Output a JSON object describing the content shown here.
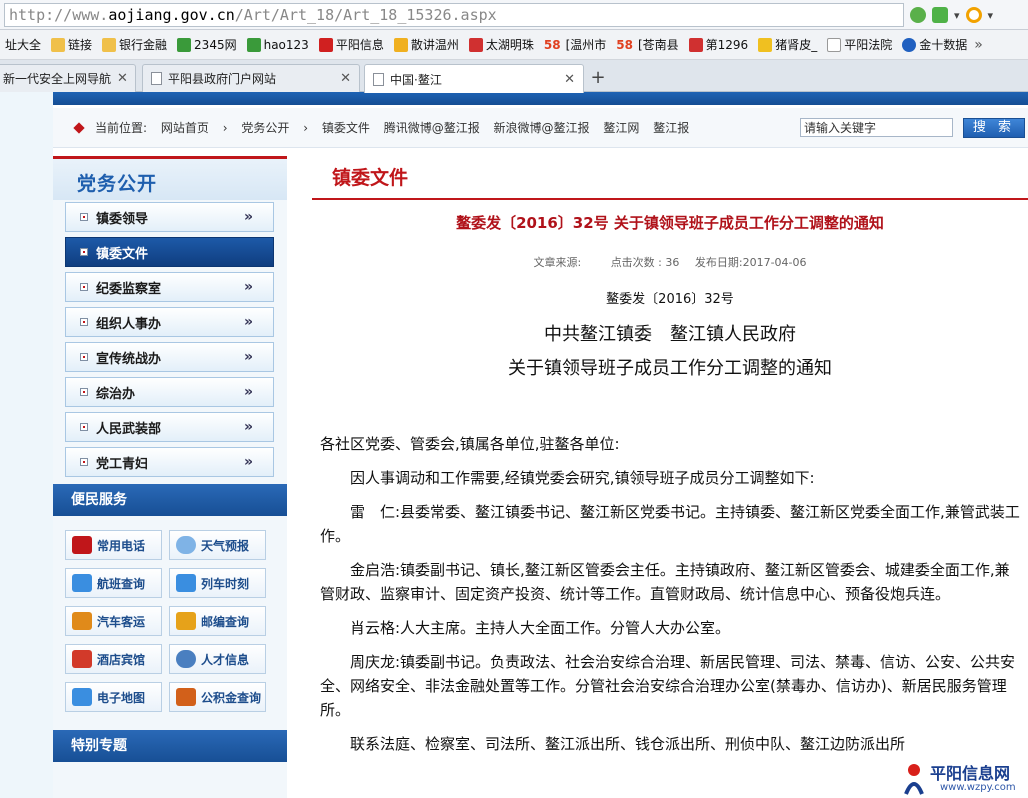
{
  "browser": {
    "url_prefix": "http://www.",
    "url_host": "aojiang.gov.cn",
    "url_path": "/Art/Art_18/Art_18_15326.aspx",
    "bookmarks": [
      "址大全",
      "链接",
      "银行金融",
      "2345网",
      "hao123",
      "平阳信息",
      "散讲温州",
      "太湖明珠",
      "58",
      "[温州市",
      "58",
      "[苍南县",
      "第1296",
      "猪肾皮_",
      "平阳法院",
      "金十数据"
    ],
    "tabs": [
      {
        "label": "新一代安全上网导航"
      },
      {
        "label": "平阳县政府门户网站"
      },
      {
        "label": "中国·鳌江"
      }
    ]
  },
  "site": {
    "breadcrumb_prefix": "当前位置:",
    "breadcrumbs": [
      "网站首页",
      "党务公开",
      "镇委文件",
      "腾讯微博@鳌江报",
      "新浪微博@鳌江报",
      "鳌江网",
      "鳌江报"
    ],
    "search_placeholder": "请输入关键字",
    "search_button": "搜 索"
  },
  "sidebar": {
    "title": "党务公开",
    "items": [
      {
        "label": "镇委领导"
      },
      {
        "label": "镇委文件"
      },
      {
        "label": "纪委监察室"
      },
      {
        "label": "组织人事办"
      },
      {
        "label": "宣传统战办"
      },
      {
        "label": "综治办"
      },
      {
        "label": "人民武装部"
      },
      {
        "label": "党工青妇"
      }
    ],
    "arrow": "»",
    "services_title": "便民服务",
    "services": [
      {
        "label": "常用电话",
        "icon": "phone-icon",
        "color": "#c0161a"
      },
      {
        "label": "天气预报",
        "icon": "weather-icon",
        "color": "#7fb3e6"
      },
      {
        "label": "航班查询",
        "icon": "plane-icon",
        "color": "#3a8ee0"
      },
      {
        "label": "列车时刻",
        "icon": "train-icon",
        "color": "#3a8ee0"
      },
      {
        "label": "汽车客运",
        "icon": "bus-icon",
        "color": "#e08a1a"
      },
      {
        "label": "邮编查询",
        "icon": "mail-icon",
        "color": "#e6a21a"
      },
      {
        "label": "酒店宾馆",
        "icon": "hotel-icon",
        "color": "#d23a2a"
      },
      {
        "label": "人才信息",
        "icon": "person-icon",
        "color": "#4a7fc0"
      },
      {
        "label": "电子地图",
        "icon": "map-icon",
        "color": "#3a8ee0"
      },
      {
        "label": "公积金查询",
        "icon": "shield-icon",
        "color": "#d2601a"
      }
    ],
    "special_title": "特别专题"
  },
  "article": {
    "section_title": "镇委文件",
    "title": "鳌委发〔2016〕32号 关于镇领导班子成员工作分工调整的通知",
    "meta_source": "文章来源:",
    "meta_clicks": "点击次数 : 36",
    "meta_date": "发布日期:2017-04-06",
    "doc_no": "鳌委发〔2016〕32号",
    "heading1": "中共鳌江镇委　鳌江镇人民政府",
    "heading2": "关于镇领导班子成员工作分工调整的通知",
    "salutation": "各社区党委、管委会,镇属各单位,驻鳌各单位:",
    "paragraphs": [
      "因人事调动和工作需要,经镇党委会研究,镇领导班子成员分工调整如下:",
      "雷　仁:县委常委、鳌江镇委书记、鳌江新区党委书记。主持镇委、鳌江新区党委全面工作,兼管武装工作。",
      "金启浩:镇委副书记、镇长,鳌江新区管委会主任。主持镇政府、鳌江新区管委会、城建委全面工作,兼管财政、监察审计、固定资产投资、统计等工作。直管财政局、统计信息中心、预备役炮兵连。",
      "肖云格:人大主席。主持人大全面工作。分管人大办公室。",
      "周庆龙:镇委副书记。负责政法、社会治安综合治理、新居民管理、司法、禁毒、信访、公安、公共安全、网络安全、非法金融处置等工作。分管社会治安综合治理办公室(禁毒办、信访办)、新居民服务管理所。",
      "联系法庭、检察室、司法所、鳌江派出所、钱仓派出所、刑侦中队、鳌江边防派出所"
    ]
  },
  "watermark": {
    "name": "平阳信息网",
    "url": "www.wzpy.com"
  }
}
